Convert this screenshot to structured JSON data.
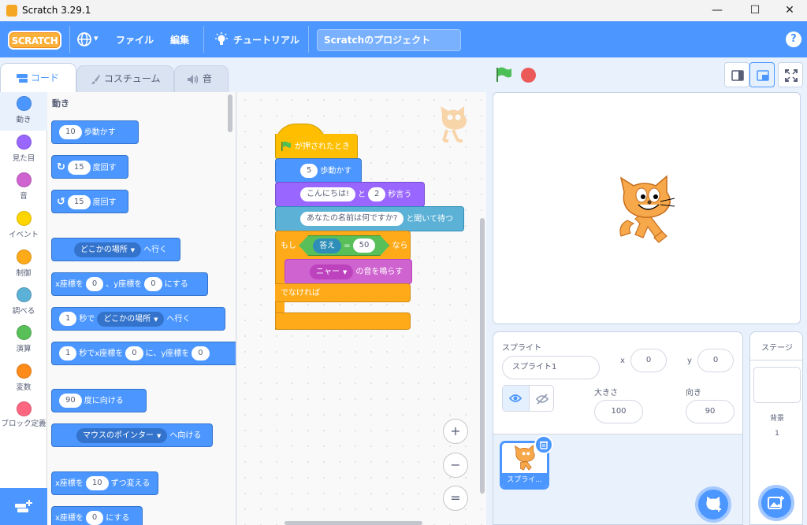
{
  "window": {
    "title": "Scratch 3.29.1",
    "minimize": "—",
    "maximize": "☐",
    "close": "✕"
  },
  "menubar": {
    "logo": "SCRATCH",
    "language_caret": "▾",
    "file": "ファイル",
    "edit": "編集",
    "tutorials": "チュートリアル",
    "project_title": "Scratchのプロジェクト",
    "help": "?"
  },
  "tabs": {
    "code": "コード",
    "costumes": "コスチューム",
    "sounds": "音"
  },
  "categories": [
    {
      "label": "動き",
      "color": "#4c97ff"
    },
    {
      "label": "見た目",
      "color": "#9966ff"
    },
    {
      "label": "音",
      "color": "#cf63cf"
    },
    {
      "label": "イベント",
      "color": "#ffd500"
    },
    {
      "label": "制御",
      "color": "#ffab19"
    },
    {
      "label": "調べる",
      "color": "#5cb1d6"
    },
    {
      "label": "演算",
      "color": "#59c059"
    },
    {
      "label": "変数",
      "color": "#ff8c1a"
    },
    {
      "label": "ブロック定義",
      "color": "#ff6680"
    }
  ],
  "palette": {
    "section_title": "動き",
    "move": {
      "value": "10",
      "text": "歩動かす"
    },
    "turn_right": {
      "value": "15",
      "text": "度回す"
    },
    "turn_left": {
      "value": "15",
      "text": "度回す"
    },
    "goto": {
      "menu": "どこかの場所",
      "text": "へ行く"
    },
    "goto_xy": {
      "a": "x座標を",
      "x": "0",
      "b": "、y座標を",
      "y": "0",
      "c": "にする"
    },
    "glide": {
      "value": "1",
      "a": "秒で",
      "menu": "どこかの場所",
      "b": "へ行く"
    },
    "glide_xy": {
      "value": "1",
      "a": "秒でx座標を",
      "x": "0",
      "b": "に、y座標を",
      "y": "0"
    },
    "point_dir": {
      "value": "90",
      "text": "度に向ける"
    },
    "point_towards": {
      "menu": "マウスのポインター",
      "text": "へ向ける"
    },
    "change_x": {
      "a": "x座標を",
      "value": "10",
      "b": "ずつ変える"
    },
    "set_x": {
      "a": "x座標を",
      "value": "0",
      "b": "にする"
    }
  },
  "script": {
    "hat": "が押されたとき",
    "move": {
      "value": "5",
      "text": "歩動かす"
    },
    "say": {
      "value": "こんにちは!",
      "a": "と",
      "secs": "2",
      "b": "秒言う"
    },
    "ask": {
      "value": "あなたの名前は何ですか?",
      "text": "と聞いて待つ"
    },
    "if": {
      "a": "もし",
      "reporter": "答え",
      "op": "=",
      "value": "50",
      "b": "なら"
    },
    "sound": {
      "menu": "ニャー",
      "text": "の音を鳴らす"
    },
    "else": "でなければ"
  },
  "zoom": {
    "in": "+",
    "out": "−",
    "reset": "="
  },
  "sprite": {
    "title": "スプライト",
    "name": "スプライト1",
    "x_label": "x",
    "x": "0",
    "y_label": "y",
    "y": "0",
    "size_label": "大きさ",
    "size": "100",
    "direction_label": "向き",
    "direction": "90",
    "thumb_label": "スプライ..."
  },
  "stage_panel": {
    "title": "ステージ",
    "backdrops_label": "背景",
    "backdrops_count": "1"
  },
  "colors": {
    "accent": "#4c97ff",
    "motion": "#4c97ff",
    "looks": "#9966ff",
    "control": "#ffab19",
    "events": "#ffbf00",
    "sensing": "#5cb1d6",
    "operators": "#59c059",
    "sound": "#cf63cf"
  }
}
